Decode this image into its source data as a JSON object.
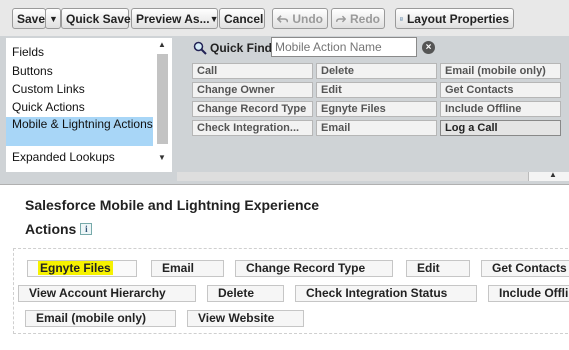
{
  "toolbar": {
    "save": "Save",
    "quick_save": "Quick Save",
    "preview_as": "Preview As...",
    "cancel": "Cancel",
    "undo": "Undo",
    "redo": "Redo",
    "layout_properties": "Layout Properties",
    "dropdown_caret": "▼",
    "icons": [
      "undo-icon",
      "redo-icon",
      "layout-properties-icon"
    ]
  },
  "palette": {
    "categories": [
      "Fields",
      "Buttons",
      "Custom Links",
      "Quick Actions",
      "Mobile & Lightning Actions",
      "Expanded Lookups"
    ],
    "selected_category": "Mobile & Lightning Actions",
    "quick_find": {
      "label": "Quick Find",
      "placeholder": "Mobile Action Name",
      "value": "",
      "clear": "×"
    },
    "items": [
      [
        "Call",
        "Delete",
        "Email (mobile only)"
      ],
      [
        "Change Owner",
        "Edit",
        "Get Contacts"
      ],
      [
        "Change Record Type",
        "Egnyte Files",
        "Include Offline"
      ],
      [
        "Check Integration...",
        "Email",
        "Log a Call"
      ]
    ],
    "active_item": "Log a Call"
  },
  "layout": {
    "section_title": "Salesforce Mobile and Lightning Experience",
    "section_subtitle": "Actions",
    "info_glyph": "i",
    "actions_row1": [
      "Egnyte Files",
      "Email",
      "Change Record Type",
      "Edit",
      "Get Contacts"
    ],
    "actions_row2": [
      "View Account Hierarchy",
      "Delete",
      "Check Integration Status",
      "Include Offli"
    ],
    "actions_row3": [
      "Email (mobile only)",
      "View Website"
    ],
    "highlighted_action": "Egnyte Files",
    "highlight_color": "#f6f200"
  },
  "colors": {
    "selected_category_bg": "#a8d6f7",
    "palette_bg": "#cfd3d6",
    "toolbar_bg": "#e8e8e8"
  }
}
